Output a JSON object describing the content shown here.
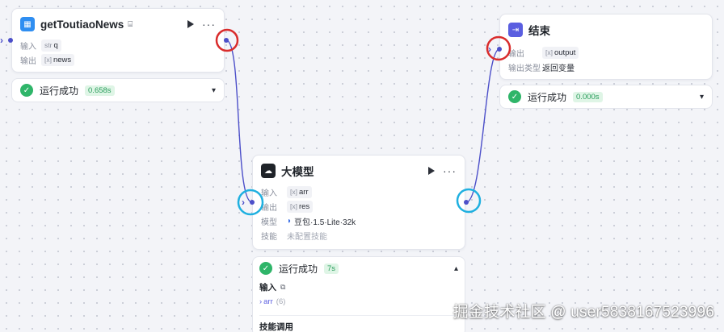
{
  "nodes": {
    "plugin": {
      "title": "getToutiaoNews",
      "input_label": "输入",
      "input_prefix": "str",
      "input_value": "q",
      "output_label": "输出",
      "output_prefix": "[x]",
      "output_value": "news",
      "status": "运行成功",
      "duration": "0.658s"
    },
    "llm": {
      "title": "大模型",
      "input_label": "输入",
      "input_prefix": "[x]",
      "input_value": "arr",
      "output_label": "输出",
      "output_prefix": "[x]",
      "output_value": "res",
      "model_label": "模型",
      "model_value": "豆包·1.5·Lite·32k",
      "skill_label": "技能",
      "skill_value": "未配置技能",
      "status": "运行成功",
      "duration": "7s",
      "panel_input_title": "输入",
      "panel_arr_label": "arr",
      "panel_arr_count": "(6)",
      "panel_skill_call": "技能调用"
    },
    "end": {
      "title": "结束",
      "output_label": "输出",
      "output_prefix": "[x]",
      "output_value": "output",
      "output_type_label": "输出类型",
      "output_type_value": "返回变量",
      "status": "运行成功",
      "duration": "0.000s"
    }
  },
  "colors": {
    "accent": "#4c4fc9",
    "success": "#2fb569",
    "highlight_red": "#d92c2c",
    "highlight_cyan": "#1fb0e0"
  },
  "watermark": "掘金技术社区 @ user5838167523996"
}
